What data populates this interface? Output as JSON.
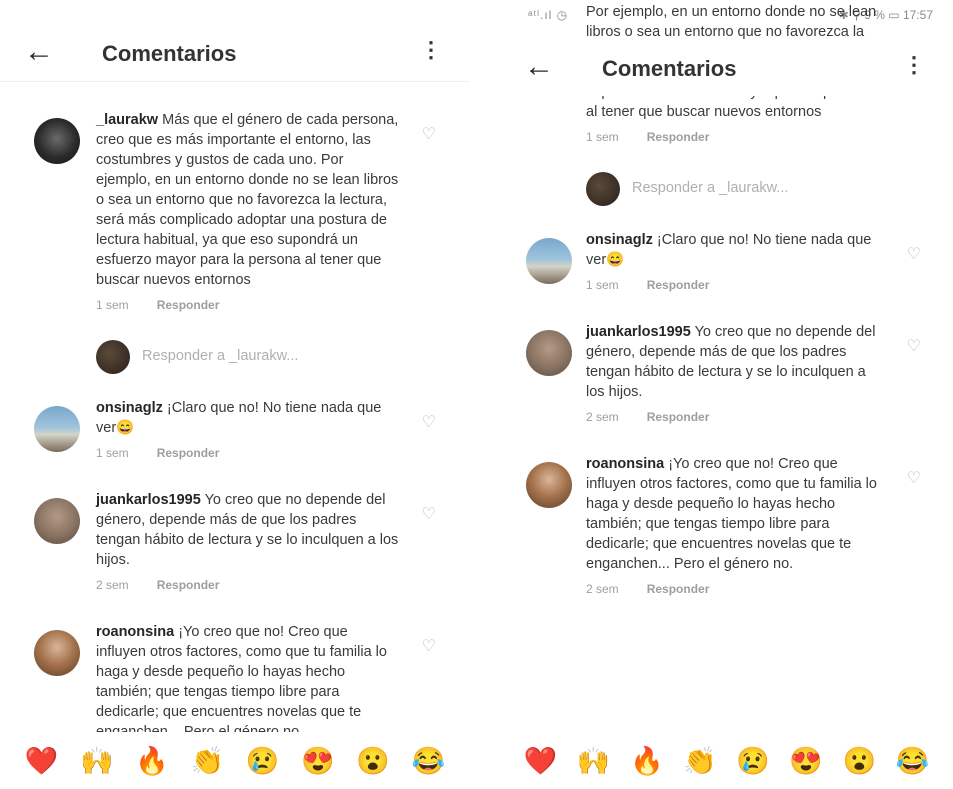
{
  "status_bar": {
    "left": "ᵃᵗˡ.ıl ◷",
    "right": "✱ ⚲ 9 % ▭ 17:57"
  },
  "header": {
    "back_icon": "←",
    "title": "Comentarios",
    "more_icon": "⋮"
  },
  "heart_icon": "♡",
  "comments": [
    {
      "user": "_laurakw",
      "text": "Más que el género de cada persona, creo que es más importante el entorno, las costumbres y gustos de cada uno. Por ejemplo, en un entorno donde no se lean libros o sea un entorno que no favorezca la lectura, será más complicado adoptar una postura de lectura habitual, ya que eso supondrá un esfuerzo mayor para la persona al tener que buscar nuevos entornos",
      "time": "1 sem",
      "reply": "Responder"
    },
    {
      "user": "onsinaglz",
      "text": "¡Claro que no! No tiene nada que ver😄",
      "time": "1 sem",
      "reply": "Responder"
    },
    {
      "user": "juankarlos1995",
      "text": "Yo creo que no depende del género, depende más de que los padres tengan hábito de lectura y se lo inculquen a los hijos.",
      "time": "2 sem",
      "reply": "Responder"
    },
    {
      "user": "roanonsina",
      "text": "¡Yo creo que no! Creo que influyen otros factores, como que tu familia lo haga y desde pequeño lo hayas hecho también; que tengas tiempo libre para dedicarle; que encuentres novelas que te enganchen... Pero el género no.",
      "time": "2 sem",
      "reply": "Responder"
    }
  ],
  "reply_placeholder": "Responder a _laurakw...",
  "emoji_bar": [
    "❤️",
    "🙌",
    "🔥",
    "👏",
    "😢",
    "😍",
    "😮",
    "😂"
  ],
  "colors": {
    "heart": "#e0243a",
    "text": "#262626",
    "muted": "#9e9e9e"
  }
}
